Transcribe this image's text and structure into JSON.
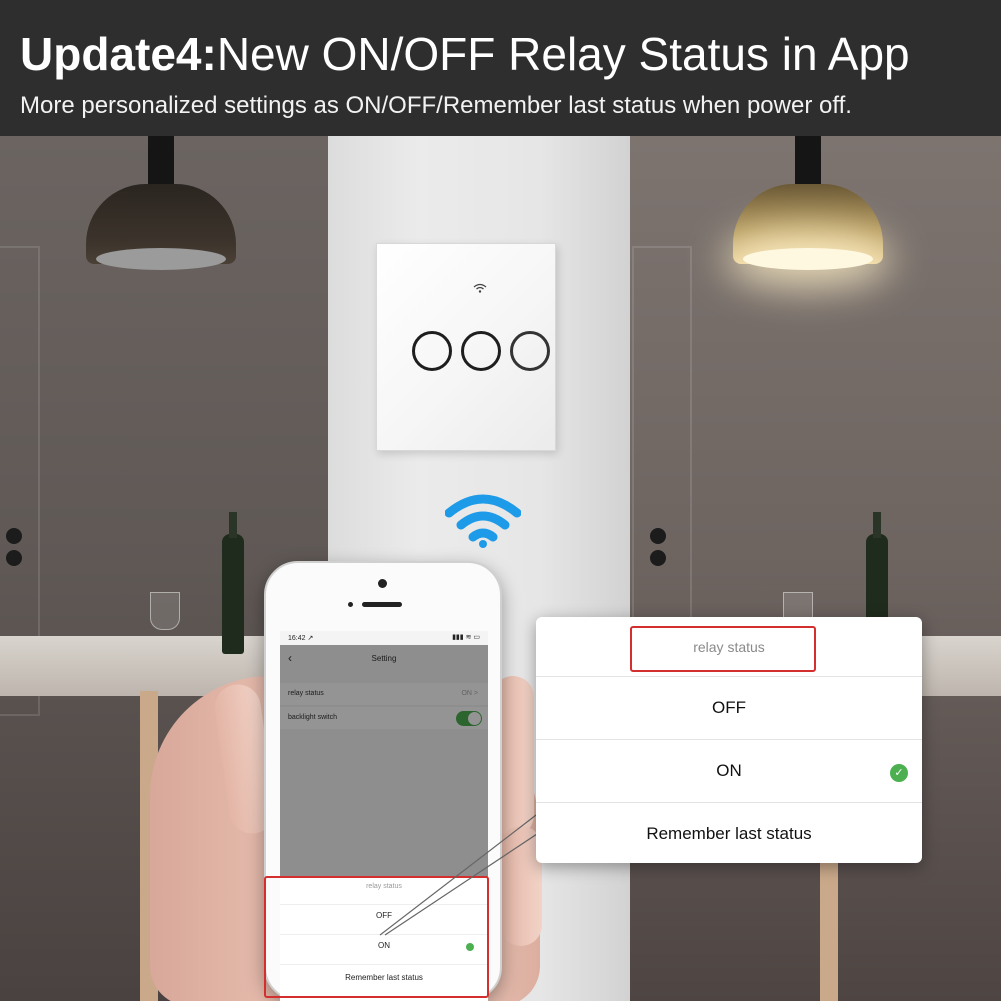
{
  "banner": {
    "title_bold": "Update4:",
    "title_rest": "New ON/OFF Relay Status in App",
    "subtitle": "More personalized settings as ON/OFF/Remember last status when power off."
  },
  "phone": {
    "status_time": "16:42 ↗",
    "status_icons": "▮▮▮ ≋ ▭",
    "nav": {
      "back_icon": "‹",
      "title": "Setting"
    },
    "settings": [
      {
        "label": "relay status",
        "value": "ON  >"
      },
      {
        "label": "backlight switch",
        "toggle": "on"
      }
    ],
    "sheet": {
      "header": "relay status",
      "options": [
        "OFF",
        "ON",
        "Remember last status"
      ],
      "selected": "ON"
    }
  },
  "popup": {
    "header": "relay status",
    "options": [
      "OFF",
      "ON",
      "Remember last status"
    ],
    "selected": "ON",
    "check_icon": "✓"
  },
  "colors": {
    "banner_bg": "#2e2e2e",
    "accent_red": "#d32f2f",
    "check_green": "#4caf50",
    "wifi_blue": "#1e9be8"
  }
}
